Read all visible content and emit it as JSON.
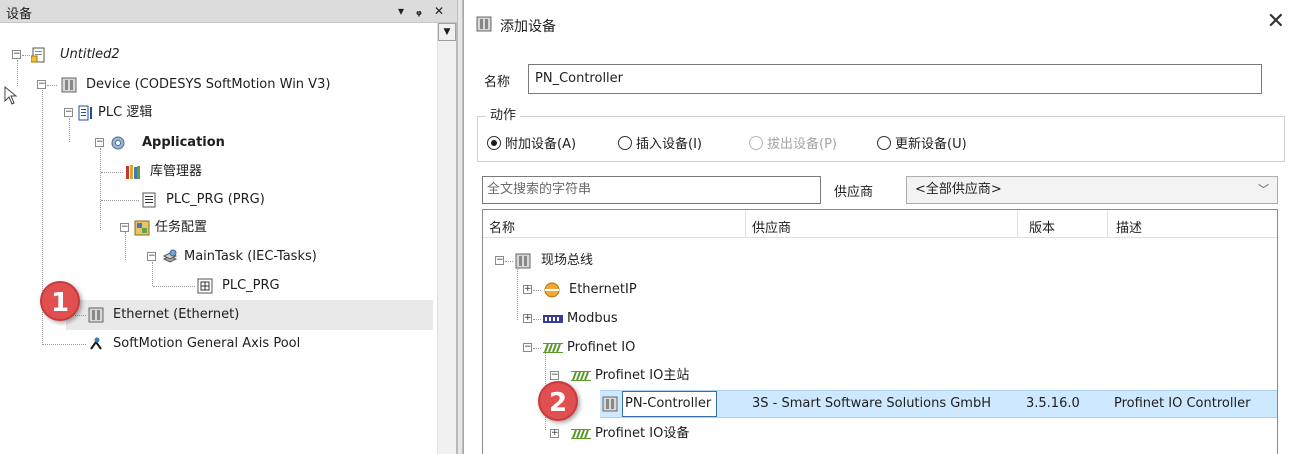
{
  "left": {
    "title": "设备",
    "controls": {
      "dropdown": "▾",
      "pin": "ᵩ",
      "close": "✕"
    },
    "tree": {
      "project": "Untitled2",
      "device": "Device (CODESYS SoftMotion Win V3)",
      "plc_logic": "PLC 逻辑",
      "application": "Application",
      "library_manager": "库管理器",
      "plc_prg": "PLC_PRG (PRG)",
      "task_config": "任务配置",
      "main_task": "MainTask (IEC-Tasks)",
      "task_prg": "PLC_PRG",
      "ethernet": "Ethernet (Ethernet)",
      "axis_pool": "SoftMotion General Axis Pool"
    },
    "badge": "1"
  },
  "dialog": {
    "title": "添加设备",
    "close": "✕",
    "name_label": "名称",
    "name_value": "PN_Controller",
    "action_group": "动作",
    "radios": [
      {
        "label": "附加设备(A)",
        "checked": true,
        "enabled": true
      },
      {
        "label": "插入设备(I)",
        "checked": false,
        "enabled": true
      },
      {
        "label": "拔出设备(P)",
        "checked": false,
        "enabled": false
      },
      {
        "label": "更新设备(U)",
        "checked": false,
        "enabled": true
      }
    ],
    "search_placeholder": "全文搜索的字符串",
    "vendor_label": "供应商",
    "vendor_value": "<全部供应商>",
    "columns": [
      "名称",
      "供应商",
      "版本",
      "描述"
    ],
    "tree": {
      "fieldbus": "现场总线",
      "ethernetip": "EthernetIP",
      "modbus": "Modbus",
      "profinet": "Profinet IO",
      "profinet_master": "Profinet IO主站",
      "profinet_device": "Profinet IO设备"
    },
    "selected_row": {
      "name": "PN-Controller",
      "vendor": "3S - Smart Software Solutions GmbH",
      "version": "3.5.16.0",
      "description": "Profinet IO Controller"
    },
    "badge": "2"
  },
  "colors": {
    "accent": "#cde8ff",
    "badge": "#e05050",
    "selection": "#e8e8e8"
  }
}
